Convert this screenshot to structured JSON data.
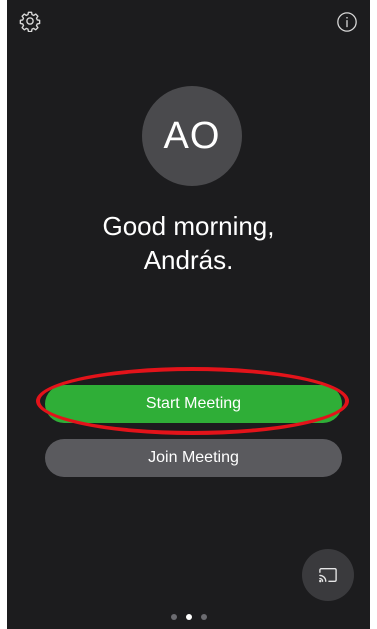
{
  "header": {
    "settings_icon": "gear-icon",
    "info_icon": "info-icon"
  },
  "profile": {
    "initials": "AO",
    "greeting_line1": "Good morning,",
    "greeting_line2": "András."
  },
  "actions": {
    "start_label": "Start Meeting",
    "join_label": "Join Meeting"
  },
  "cast": {
    "icon": "screen-share-icon"
  },
  "pager": {
    "count": 3,
    "active_index": 1
  },
  "colors": {
    "background": "#1c1c1e",
    "start_button": "#2fae37",
    "join_button": "#5a5a5e",
    "avatar": "#4a4a4d",
    "highlight": "#e3131a"
  }
}
